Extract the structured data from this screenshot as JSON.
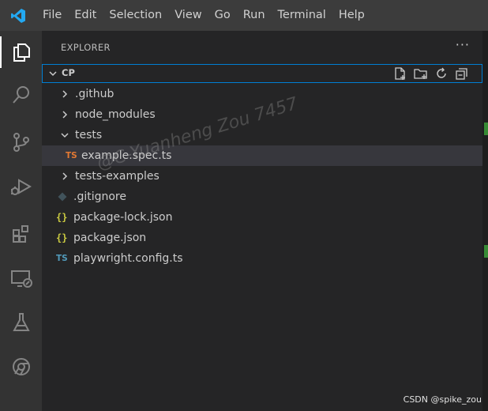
{
  "menu": [
    "File",
    "Edit",
    "Selection",
    "View",
    "Go",
    "Run",
    "Terminal",
    "Help"
  ],
  "activity_bar": [
    "explorer-icon",
    "search-icon",
    "source-control-icon",
    "run-debug-icon",
    "extensions-icon",
    "remote-explorer-icon",
    "testing-icon",
    "chrome-icon"
  ],
  "explorer": {
    "title": "EXPLORER",
    "more": "···",
    "folder": "CP",
    "items": [
      {
        "label": ".github",
        "type": "folder",
        "icon": "chevron-right-icon"
      },
      {
        "label": "node_modules",
        "type": "folder",
        "icon": "chevron-right-icon"
      },
      {
        "label": "tests",
        "type": "folder-open",
        "icon": "chevron-down-icon"
      },
      {
        "label": "example.spec.ts",
        "type": "file",
        "badge": "TS",
        "selected": true
      },
      {
        "label": "tests-examples",
        "type": "folder",
        "icon": "chevron-right-icon"
      },
      {
        "label": ".gitignore",
        "type": "file"
      },
      {
        "label": "package-lock.json",
        "type": "file",
        "badge": "{}"
      },
      {
        "label": "package.json",
        "type": "file",
        "badge": "{}"
      },
      {
        "label": "playwright.config.ts",
        "type": "file",
        "badge": "TS"
      }
    ]
  },
  "watermark": "@C-Yuanheng Zou 7457",
  "footer_credit": "CSDN @spike_zou",
  "colors": {
    "ts_spec": "#e37933",
    "ts_config": "#519aba",
    "json": "#cbcb41",
    "focus_border": "#007fd4",
    "vscode_blue": "#23a9f2"
  }
}
